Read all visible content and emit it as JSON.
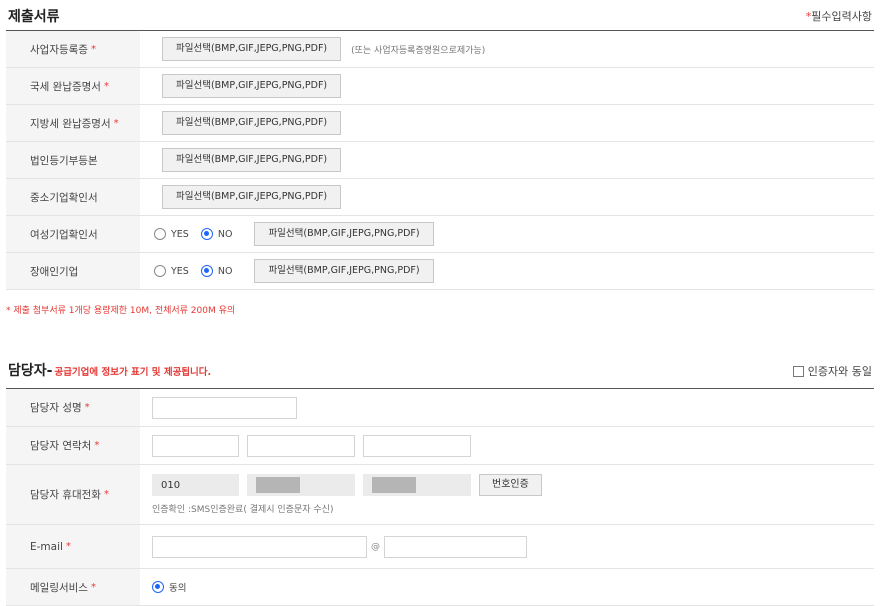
{
  "submission": {
    "title": "제출서류",
    "required_note": "필수입력사항",
    "rows": [
      {
        "label": "사업자등록증",
        "file_btn": "파일선택(BMP,GIF,JEPG,PNG,PDF)",
        "hint": "(또는 사업자등록증명원으로제가능)"
      },
      {
        "label": "국세 완납증명서",
        "file_btn": "파일선택(BMP,GIF,JEPG,PNG,PDF)"
      },
      {
        "label": "지방세 완납증명서",
        "file_btn": "파일선택(BMP,GIF,JEPG,PNG,PDF)"
      },
      {
        "label": "법인등기부등본",
        "file_btn": "파일선택(BMP,GIF,JEPG,PNG,PDF)"
      },
      {
        "label": "중소기업확인서",
        "file_btn": "파일선택(BMP,GIF,JEPG,PNG,PDF)"
      },
      {
        "label": "여성기업확인서",
        "yes": "YES",
        "no": "NO",
        "file_btn": "파일선택(BMP,GIF,JEPG,PNG,PDF)"
      },
      {
        "label": "장애인기업",
        "yes": "YES",
        "no": "NO",
        "file_btn": "파일선택(BMP,GIF,JEPG,PNG,PDF)"
      }
    ],
    "size_note": "* 제출 첨부서류 1개당 용량제한 10M, 전체서류 200M 유의"
  },
  "manager": {
    "title": "담당자",
    "dash": "-",
    "subtitle": "공급기업에 정보가 표기 및 제공됩니다.",
    "same_label": "인증자와 동일",
    "name_label": "담당자 성명",
    "contact_label": "담당자 연락처",
    "mobile_label": "담당자 휴대전화",
    "mobile_prefix": "010",
    "verify_btn": "번호인증",
    "verify_note": "인증확인 :SMS인증완료( 결제시 인증문자 수신)",
    "email_label": "E-mail",
    "email_at": "@",
    "mailing_label": "메일링서비스",
    "mailing_option": "동의"
  },
  "colors": {
    "required": "#e53935",
    "radio_on": "#1e66f5"
  }
}
